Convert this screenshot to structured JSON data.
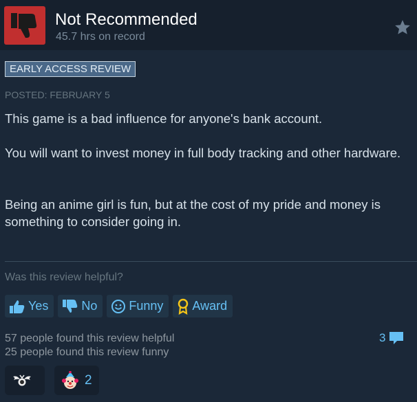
{
  "header": {
    "verdict": "Not Recommended",
    "hours": "45.7 hrs on record",
    "thumb_icon": "thumbs-down-icon",
    "star_icon": "star-icon",
    "verdict_color": "#c12f2f"
  },
  "badge": "EARLY ACCESS REVIEW",
  "posted": "POSTED: FEBRUARY 5",
  "review": {
    "paragraphs": [
      "This game is a bad influence for anyone's bank account.",
      "You will want to invest money in full body tracking and other hardware.",
      "Being an anime girl is fun, but at the cost of my pride and money is something to consider going in."
    ]
  },
  "helpful_prompt": "Was this review helpful?",
  "buttons": {
    "yes": "Yes",
    "no": "No",
    "funny": "Funny",
    "award": "Award"
  },
  "stats": {
    "helpful": "57 people found this review helpful",
    "funny": "25 people found this review funny"
  },
  "comments": {
    "count": "3",
    "icon": "comment-icon"
  },
  "awards": [
    {
      "icon": "winged-award-icon",
      "count": ""
    },
    {
      "icon": "clown-award-icon",
      "count": "2"
    }
  ],
  "colors": {
    "background": "#1b2838",
    "header_background": "#16202d",
    "link_blue": "#66c0f4",
    "muted_text": "#8f98a0"
  }
}
